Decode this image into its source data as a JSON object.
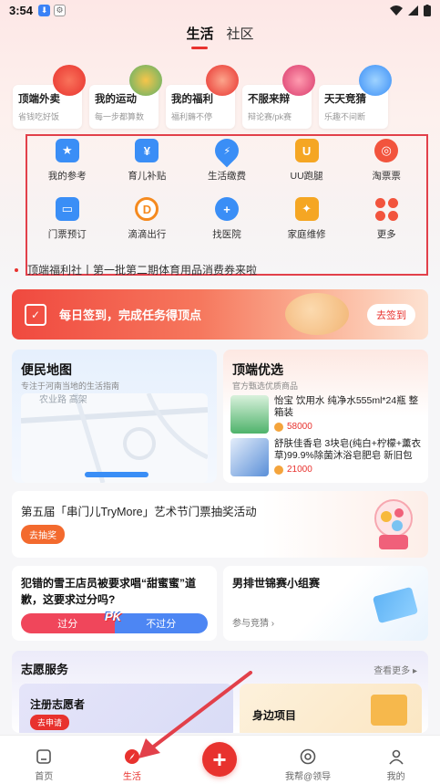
{
  "status": {
    "time": "3:54"
  },
  "header": {
    "tabs": [
      {
        "label": "生活",
        "active": true
      },
      {
        "label": "社区",
        "active": false
      }
    ]
  },
  "top_cards": [
    {
      "title": "顶端外卖",
      "subtitle": "省钱吃好饭"
    },
    {
      "title": "我的运动",
      "subtitle": "每一步都算数"
    },
    {
      "title": "我的福利",
      "subtitle": "福利薅不停"
    },
    {
      "title": "不服来辩",
      "subtitle": "辩论赛/pk赛"
    },
    {
      "title": "天天竞猜",
      "subtitle": "乐趣不间断"
    }
  ],
  "services": [
    {
      "label": "我的参考",
      "icon": "star-doc-icon",
      "color": "#3a8ef6"
    },
    {
      "label": "育儿补贴",
      "icon": "baby-bag-icon",
      "color": "#3a8ef6"
    },
    {
      "label": "生活缴费",
      "icon": "water-drop-icon",
      "color": "#3a8ef6"
    },
    {
      "label": "UU跑腿",
      "icon": "uu-icon",
      "color": "#f5a623"
    },
    {
      "label": "淘票票",
      "icon": "glasses-icon",
      "color": "#f2543d"
    },
    {
      "label": "门票预订",
      "icon": "ticket-icon",
      "color": "#3a8ef6"
    },
    {
      "label": "滴滴出行",
      "icon": "didi-icon",
      "color": "#f58a1f"
    },
    {
      "label": "找医院",
      "icon": "hospital-icon",
      "color": "#3a8ef6"
    },
    {
      "label": "家庭维修",
      "icon": "wrench-icon",
      "color": "#f5a623"
    },
    {
      "label": "更多",
      "icon": "more-dots-icon",
      "color": "#f2543d"
    }
  ],
  "ticker": {
    "text": "顶端福利社丨第一批第二期体育用品消费券来啦"
  },
  "signin": {
    "text": "每日签到，完成任务得顶点",
    "button": "去签到"
  },
  "map": {
    "title": "便民地图",
    "subtitle": "专注于河南当地的生活指南",
    "map_text": "农业路  高架"
  },
  "best": {
    "title": "顶端优选",
    "subtitle": "官方甄选优质商品",
    "products": [
      {
        "name": "怡宝 饮用水 纯净水555ml*24瓶 整箱装",
        "price": "58000"
      },
      {
        "name": "舒肤佳香皂 3块皂(纯白+柠檬+薰衣草)99.9%除菌沐浴皂肥皂 新旧包装...",
        "price": "21000"
      }
    ]
  },
  "event": {
    "title": "第五届「串门儿TryMore」艺术节门票抽奖活动",
    "button": "去抽奖"
  },
  "vote": {
    "title": "犯错的雪王店员被要求唱“甜蜜蜜”道歉，这要求过分吗?",
    "option_a": "过分",
    "option_b": "不过分",
    "pk": "PK"
  },
  "guess": {
    "title": "男排世锦赛小组赛",
    "action": "参与竞猜"
  },
  "volunteer": {
    "title": "志愿服务",
    "more": "查看更多",
    "card1_title": "注册志愿者",
    "card1_button": "去申请",
    "card2_title": "身边项目"
  },
  "nav": [
    {
      "label": "首页",
      "active": false
    },
    {
      "label": "生活",
      "active": true
    },
    {
      "label": "",
      "active": false
    },
    {
      "label": "我帮@领导",
      "active": false
    },
    {
      "label": "我的",
      "active": false
    }
  ]
}
